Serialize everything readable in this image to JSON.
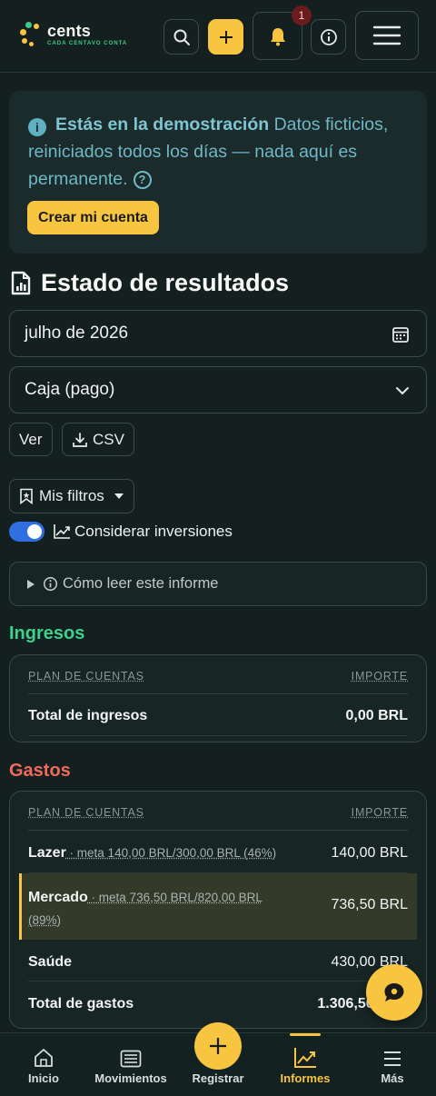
{
  "brand": {
    "name": "cents",
    "tagline": "CADA CENTAVO CONTA",
    "accent": "#f7c540",
    "green": "#3fc98a"
  },
  "header": {
    "notifications_count": "1"
  },
  "demo_banner": {
    "strong": "Estás en la demostración",
    "text": " Datos ficticios, reiniciados todos los días — nada aquí es permanente.",
    "help": "?",
    "create_button": "Crear mi cuenta"
  },
  "page": {
    "title": "Estado de resultados",
    "period": "julho de 2026",
    "basis": "Caja (pago)",
    "view_button": "Ver",
    "csv_button": "CSV",
    "filters_button": "Mis filtros",
    "toggle_label": "Considerar inversiones",
    "toggle_on": true,
    "how_to_read": "Cómo leer este informe"
  },
  "income": {
    "title": "Ingresos",
    "col_account": "PLAN DE CUENTAS",
    "col_amount": "IMPORTE",
    "total_label": "Total de ingresos",
    "total_value": "0,00 BRL"
  },
  "expenses": {
    "title": "Gastos",
    "col_account": "PLAN DE CUENTAS",
    "col_amount": "IMPORTE",
    "rows": [
      {
        "name": "Lazer",
        "meta": " · meta 140,00 BRL/300,00 BRL (46%)",
        "amount": "140,00 BRL"
      },
      {
        "name": "Mercado",
        "meta": " · meta 736,50 BRL/820,00 BRL (89%)",
        "amount": "736,50 BRL"
      },
      {
        "name": "Saúde",
        "meta": "",
        "amount": "430,00 BRL"
      }
    ],
    "total_label": "Total de gastos",
    "total_value": "1.306,50 BRL"
  },
  "bottom_nav": {
    "home": "Inicio",
    "movements": "Movimientos",
    "register": "Registrar",
    "reports": "Informes",
    "more": "Más"
  }
}
